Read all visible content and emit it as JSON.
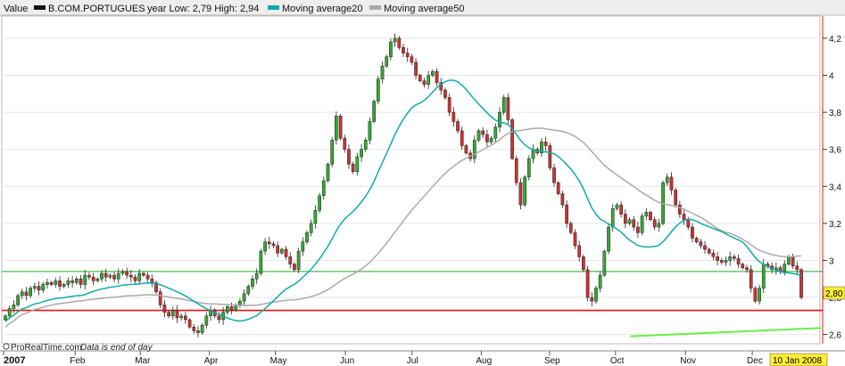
{
  "chart_data": {
    "type": "candlestick",
    "legend": {
      "value_label": "Value",
      "symbol": "B.COM.PORTUGUES",
      "range_text": "year Low: 2,79 High: 2,94",
      "ma20_label": "Moving average20",
      "ma50_label": "Moving average50",
      "colors": {
        "symbol": "#111111",
        "ma20": "#11aaaa",
        "ma50": "#aaaaaa"
      }
    },
    "y_axis": {
      "min": 2.55,
      "max": 4.32,
      "ticks": [
        {
          "value": 2.6,
          "label": "2,6"
        },
        {
          "value": 2.8,
          "label": "2,8"
        },
        {
          "value": 3.0,
          "label": "3"
        },
        {
          "value": 3.2,
          "label": "3,2"
        },
        {
          "value": 3.4,
          "label": "3,4"
        },
        {
          "value": 3.6,
          "label": "3,6"
        },
        {
          "value": 3.8,
          "label": "3,8"
        },
        {
          "value": 4.0,
          "label": "4"
        },
        {
          "value": 4.2,
          "label": "4,2"
        }
      ]
    },
    "x_axis": {
      "labels": [
        {
          "label": "2007",
          "pos": 0.0,
          "bold": true
        },
        {
          "label": "Feb",
          "pos": 0.088
        },
        {
          "label": "Mar",
          "pos": 0.168
        },
        {
          "label": "Apr",
          "pos": 0.253
        },
        {
          "label": "May",
          "pos": 0.334
        },
        {
          "label": "Jun",
          "pos": 0.42
        },
        {
          "label": "Jul",
          "pos": 0.502
        },
        {
          "label": "Aug",
          "pos": 0.587
        },
        {
          "label": "Sep",
          "pos": 0.671
        },
        {
          "label": "Oct",
          "pos": 0.752
        },
        {
          "label": "Nov",
          "pos": 0.838
        },
        {
          "label": "Dec",
          "pos": 0.92
        }
      ],
      "current_date": "10 Jan 2008"
    },
    "current_value_label": "2,80",
    "horizontal_lines": [
      {
        "value": 2.94,
        "color": "#22aa22"
      },
      {
        "value": 2.73,
        "color": "#ee1111"
      }
    ],
    "trend_line": {
      "from": [
        0.77,
        2.59
      ],
      "to": [
        1.0,
        2.635
      ],
      "color": "#66ee44"
    },
    "closes": [
      2.7,
      2.74,
      2.76,
      2.81,
      2.83,
      2.81,
      2.85,
      2.86,
      2.84,
      2.87,
      2.88,
      2.87,
      2.89,
      2.86,
      2.87,
      2.89,
      2.88,
      2.9,
      2.87,
      2.92,
      2.91,
      2.89,
      2.9,
      2.93,
      2.91,
      2.92,
      2.9,
      2.93,
      2.94,
      2.92,
      2.91,
      2.89,
      2.93,
      2.92,
      2.9,
      2.88,
      2.83,
      2.76,
      2.72,
      2.7,
      2.73,
      2.69,
      2.7,
      2.68,
      2.64,
      2.62,
      2.61,
      2.65,
      2.7,
      2.73,
      2.7,
      2.68,
      2.72,
      2.75,
      2.73,
      2.76,
      2.78,
      2.82,
      2.86,
      2.9,
      2.93,
      3.05,
      3.1,
      3.09,
      3.08,
      3.04,
      3.06,
      3.02,
      2.98,
      2.95,
      3.05,
      3.1,
      3.15,
      3.2,
      3.27,
      3.35,
      3.43,
      3.52,
      3.65,
      3.78,
      3.66,
      3.6,
      3.52,
      3.48,
      3.56,
      3.6,
      3.65,
      3.75,
      3.86,
      3.98,
      4.05,
      4.1,
      4.18,
      4.2,
      4.15,
      4.12,
      4.1,
      4.07,
      4.0,
      3.97,
      3.95,
      4.0,
      4.02,
      3.96,
      3.92,
      3.88,
      3.8,
      3.75,
      3.7,
      3.62,
      3.58,
      3.55,
      3.65,
      3.7,
      3.68,
      3.64,
      3.66,
      3.72,
      3.8,
      3.88,
      3.76,
      3.55,
      3.42,
      3.3,
      3.45,
      3.55,
      3.6,
      3.58,
      3.64,
      3.62,
      3.5,
      3.42,
      3.36,
      3.3,
      3.2,
      3.15,
      3.08,
      3.02,
      2.95,
      2.8,
      2.78,
      2.85,
      2.92,
      3.05,
      3.18,
      3.28,
      3.3,
      3.25,
      3.2,
      3.22,
      3.18,
      3.15,
      3.24,
      3.26,
      3.22,
      3.18,
      3.2,
      3.42,
      3.45,
      3.38,
      3.3,
      3.25,
      3.22,
      3.18,
      3.12,
      3.1,
      3.08,
      3.06,
      3.04,
      3.02,
      3.0,
      2.99,
      3.0,
      3.02,
      3.01,
      2.98,
      2.96,
      2.95,
      2.85,
      2.78,
      2.85,
      2.98,
      2.97,
      2.95,
      2.96,
      2.94,
      2.98,
      3.02,
      2.97,
      2.95,
      2.8
    ]
  }
}
